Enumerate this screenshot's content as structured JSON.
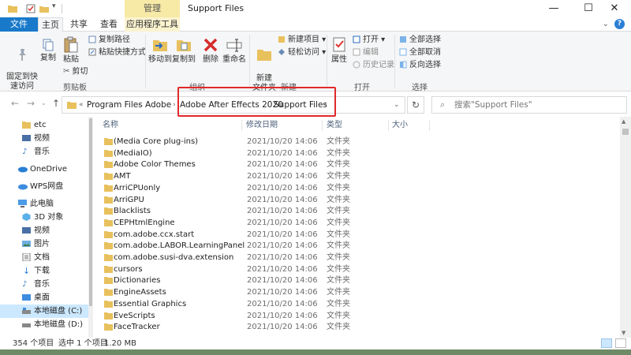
{
  "window": {
    "title": "Support Files",
    "context_tab": "管理"
  },
  "tabs": {
    "file": "文件",
    "home": "主页",
    "share": "共享",
    "view": "查看",
    "app_tools": "应用程序工具"
  },
  "ribbon": {
    "clipboard": {
      "group_label": "剪贴板",
      "pin_quick_access": "固定到快\n速访问",
      "copy": "复制",
      "paste": "粘贴",
      "copy_path": "复制路径",
      "paste_shortcut": "粘贴快捷方式",
      "cut": "剪切"
    },
    "organize": {
      "group_label": "组织",
      "move_to": "移动到",
      "copy_to": "复制到",
      "delete": "删除",
      "rename": "重命名"
    },
    "new": {
      "group_label": "新建",
      "new_folder": "新建\n文件夹",
      "new_item": "新建项目",
      "easy_access": "轻松访问"
    },
    "open": {
      "group_label": "打开",
      "properties": "属性",
      "open": "打开",
      "edit": "编辑",
      "history": "历史记录"
    },
    "select": {
      "group_label": "选择",
      "select_all": "全部选择",
      "select_none": "全部取消",
      "invert": "反向选择"
    }
  },
  "address": {
    "overflow": "«",
    "crumbs": [
      "Program Files",
      "Adobe",
      "Adobe After Effects 2020",
      "Support Files"
    ],
    "search_placeholder": "搜索\"Support Files\""
  },
  "sidebar": {
    "items": [
      {
        "label": "etc",
        "icon": "folder-icon"
      },
      {
        "label": "视频",
        "icon": "video-icon"
      },
      {
        "label": "音乐",
        "icon": "music-icon"
      },
      {
        "label": "OneDrive",
        "icon": "cloud-icon"
      },
      {
        "label": "WPS网盘",
        "icon": "wps-cloud-icon"
      },
      {
        "label": "此电脑",
        "icon": "computer-icon"
      },
      {
        "label": "3D 对象",
        "icon": "cube-icon"
      },
      {
        "label": "视频",
        "icon": "video-icon"
      },
      {
        "label": "图片",
        "icon": "picture-icon"
      },
      {
        "label": "文档",
        "icon": "document-icon"
      },
      {
        "label": "下载",
        "icon": "download-icon"
      },
      {
        "label": "音乐",
        "icon": "music-icon"
      },
      {
        "label": "桌面",
        "icon": "desktop-icon"
      },
      {
        "label": "本地磁盘 (C:)",
        "icon": "drive-icon"
      },
      {
        "label": "本地磁盘 (D:)",
        "icon": "drive-icon"
      }
    ]
  },
  "columns": {
    "name": "名称",
    "date": "修改日期",
    "type": "类型",
    "size": "大小"
  },
  "files": [
    {
      "name": "(Media Core plug-ins)",
      "date": "2021/10/20 14:06",
      "type": "文件夹"
    },
    {
      "name": "(MediaIO)",
      "date": "2021/10/20 14:06",
      "type": "文件夹"
    },
    {
      "name": "Adobe Color Themes",
      "date": "2021/10/20 14:06",
      "type": "文件夹"
    },
    {
      "name": "AMT",
      "date": "2021/10/20 14:06",
      "type": "文件夹"
    },
    {
      "name": "ArriCPUonly",
      "date": "2021/10/20 14:06",
      "type": "文件夹"
    },
    {
      "name": "ArriGPU",
      "date": "2021/10/20 14:06",
      "type": "文件夹"
    },
    {
      "name": "Blacklists",
      "date": "2021/10/20 14:06",
      "type": "文件夹"
    },
    {
      "name": "CEPHtmlEngine",
      "date": "2021/10/20 14:06",
      "type": "文件夹"
    },
    {
      "name": "com.adobe.ccx.start",
      "date": "2021/10/20 14:06",
      "type": "文件夹"
    },
    {
      "name": "com.adobe.LABOR.LearningPanel",
      "date": "2021/10/20 14:06",
      "type": "文件夹"
    },
    {
      "name": "com.adobe.susi-dva.extension",
      "date": "2021/10/20 14:06",
      "type": "文件夹"
    },
    {
      "name": "cursors",
      "date": "2021/10/20 14:06",
      "type": "文件夹"
    },
    {
      "name": "Dictionaries",
      "date": "2021/10/20 14:06",
      "type": "文件夹"
    },
    {
      "name": "EngineAssets",
      "date": "2021/10/20 14:06",
      "type": "文件夹"
    },
    {
      "name": "Essential Graphics",
      "date": "2021/10/20 14:06",
      "type": "文件夹"
    },
    {
      "name": "EveScripts",
      "date": "2021/10/20 14:06",
      "type": "文件夹"
    },
    {
      "name": "FaceTracker",
      "date": "2021/10/20 14:06",
      "type": "文件夹"
    }
  ],
  "status": {
    "item_count": "354 个项目",
    "selected": "选中 1 个项目",
    "size": "1.20 MB"
  },
  "colors": {
    "accent": "#1979ca",
    "folder": "#e8c15d",
    "highlight_box": "#e0292b",
    "selection": "#cce8ff"
  }
}
